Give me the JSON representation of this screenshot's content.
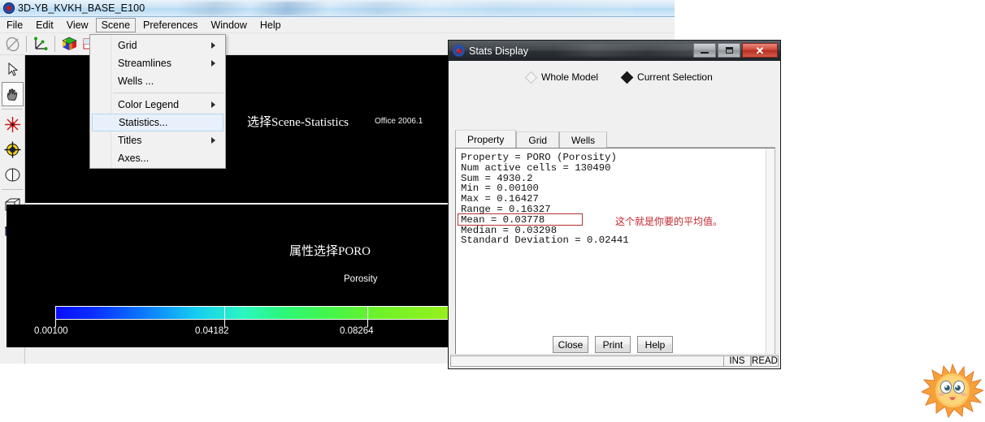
{
  "app": {
    "title": "3D-YB_KVKH_BASE_E100",
    "icon": "app-logo-icon",
    "menubar": [
      {
        "label": "File",
        "open": false
      },
      {
        "label": "Edit",
        "open": false
      },
      {
        "label": "View",
        "open": false
      },
      {
        "label": "Scene",
        "open": true
      },
      {
        "label": "Preferences",
        "open": false
      },
      {
        "label": "Window",
        "open": false
      },
      {
        "label": "Help",
        "open": false
      }
    ],
    "toolbar": [
      {
        "name": "ellipse-shade-icon"
      },
      {
        "name": "axes-triad-icon"
      },
      {
        "name": "color-cube-icon"
      },
      {
        "name": "grid-cube-icon"
      },
      {
        "name": "play-arrow-icon"
      },
      {
        "name": "sort-z-descending-icon"
      }
    ],
    "tool_palette": [
      {
        "name": "select-arrow-tool",
        "pressed": false
      },
      {
        "name": "pan-hand-tool",
        "pressed": true
      },
      {
        "name": "rotate-center-tool",
        "pressed": false
      },
      {
        "name": "move-target-tool",
        "pressed": false
      },
      {
        "name": "slice-tool",
        "pressed": false
      },
      {
        "name": "wireframe-cube-tool",
        "pressed": false
      },
      {
        "name": "solid-cube-tool",
        "pressed": false
      }
    ]
  },
  "scene_menu": {
    "items": [
      {
        "label": "Grid",
        "submenu": true,
        "selected": false
      },
      {
        "label": "Streamlines",
        "submenu": true,
        "selected": false
      },
      {
        "label": "Wells ...",
        "submenu": false,
        "selected": false
      },
      {
        "separator": true
      },
      {
        "label": "Color Legend",
        "submenu": true,
        "selected": false
      },
      {
        "label": "Statistics...",
        "submenu": false,
        "selected": true
      },
      {
        "label": "Titles",
        "submenu": true,
        "selected": false
      },
      {
        "label": "Axes...",
        "submenu": false,
        "selected": false
      }
    ]
  },
  "viewport": {
    "annotation": "选择Scene-Statistics",
    "watermark": "Office 2006.1",
    "background_color": "#000000"
  },
  "legend": {
    "annotation": "属性选择PORO",
    "title": "Porosity",
    "ticks": [
      "0.00100",
      "0.04182",
      "0.08264"
    ],
    "gradient_start": "#0a0aff",
    "gradient_end": "#97f01c"
  },
  "stats_dialog": {
    "title": "Stats Display",
    "icon": "app-logo-icon",
    "window_buttons": [
      {
        "name": "minimize-button",
        "glyph": "minimize"
      },
      {
        "name": "maximize-button",
        "glyph": "maximize"
      },
      {
        "name": "close-button",
        "glyph": "close"
      }
    ],
    "scope": [
      {
        "label": "Whole Model",
        "selected": false
      },
      {
        "label": "Current Selection",
        "selected": true
      }
    ],
    "tabs": [
      {
        "label": "Property",
        "active": true
      },
      {
        "label": "Grid",
        "active": false
      },
      {
        "label": "Wells",
        "active": false
      }
    ],
    "report": "Property = PORO (Porosity)\nNum active cells = 130490\nSum = 4930.2\nMin = 0.00100\nMax = 0.16427\nRange = 0.16327\nMean = 0.03778\nMedian = 0.03298\nStandard Deviation = 0.02441",
    "stats": {
      "property": "PORO (Porosity)",
      "num_active_cells": "130490",
      "sum": "4930.2",
      "min": "0.00100",
      "max": "0.16427",
      "range": "0.16327",
      "mean": "0.03778",
      "median": "0.03298",
      "standard_deviation": "0.02441"
    },
    "annotation": {
      "text": "这个就是你要的平均值。",
      "color": "#c1272d",
      "highlights": "Mean = 0.03778"
    },
    "buttons": [
      {
        "label": "Close",
        "name": "close-dialog-button"
      },
      {
        "label": "Print",
        "name": "print-button"
      },
      {
        "label": "Help",
        "name": "help-button"
      }
    ],
    "statusbar": {
      "message": "",
      "cells": [
        "INS",
        "READ"
      ]
    }
  },
  "sticker": {
    "name": "sun-face-sticker"
  }
}
